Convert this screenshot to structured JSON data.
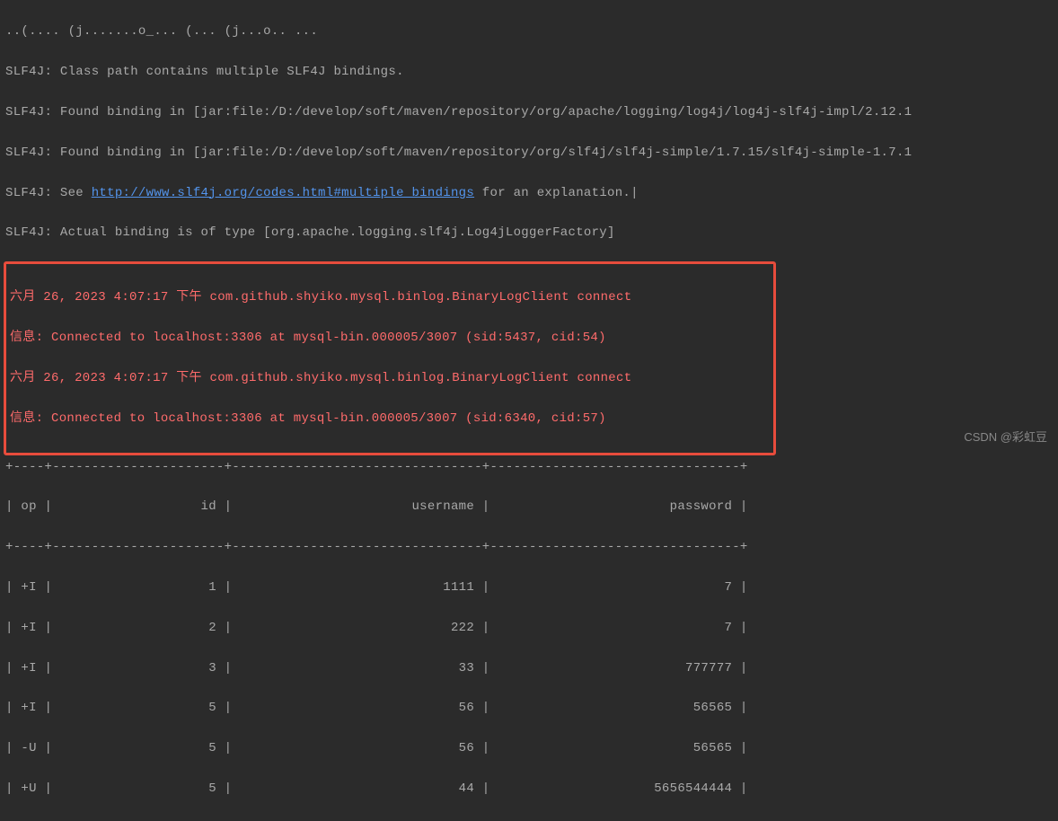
{
  "log": {
    "top_fragment": "..(.... (j.......o_... (... (j...o.. ...",
    "slf4j_1": "SLF4J: Class path contains multiple SLF4J bindings.",
    "slf4j_2": "SLF4J: Found binding in [jar:file:/D:/develop/soft/maven/repository/org/apache/logging/log4j/log4j-slf4j-impl/2.12.1",
    "slf4j_3": "SLF4J: Found binding in [jar:file:/D:/develop/soft/maven/repository/org/slf4j/slf4j-simple/1.7.15/slf4j-simple-1.7.1",
    "slf4j_4_prefix": "SLF4J: See ",
    "slf4j_4_link": "http://www.slf4j.org/codes.html#multiple_bindings",
    "slf4j_4_suffix": " for an explanation.",
    "slf4j_5": "SLF4J: Actual binding is of type [org.apache.logging.slf4j.Log4jLoggerFactory]",
    "highlighted": {
      "line1": "六月 26, 2023 4:07:17 下午 com.github.shyiko.mysql.binlog.BinaryLogClient connect",
      "line2": "信息: Connected to localhost:3306 at mysql-bin.000005/3007 (sid:5437, cid:54)",
      "line3": "六月 26, 2023 4:07:17 下午 com.github.shyiko.mysql.binlog.BinaryLogClient connect",
      "line4": "信息: Connected to localhost:3306 at mysql-bin.000005/3007 (sid:6340, cid:57)"
    }
  },
  "table": {
    "border_top": "+----+----------------------+--------------------------------+--------------------------------+",
    "header": "| op |                   id |                       username |                       password |",
    "border_mid": "+----+----------------------+--------------------------------+--------------------------------+",
    "rows": [
      "| +I |                    1 |                           1111 |                              7 |",
      "| +I |                    2 |                            222 |                              7 |",
      "| +I |                    3 |                             33 |                         777777 |",
      "| +I |                    5 |                             56 |                          56565 |",
      "| -U |                    5 |                             56 |                          56565 |",
      "| +U |                    5 |                             44 |                     5656544444 |"
    ]
  },
  "watermark": "CSDN @彩虹豆"
}
